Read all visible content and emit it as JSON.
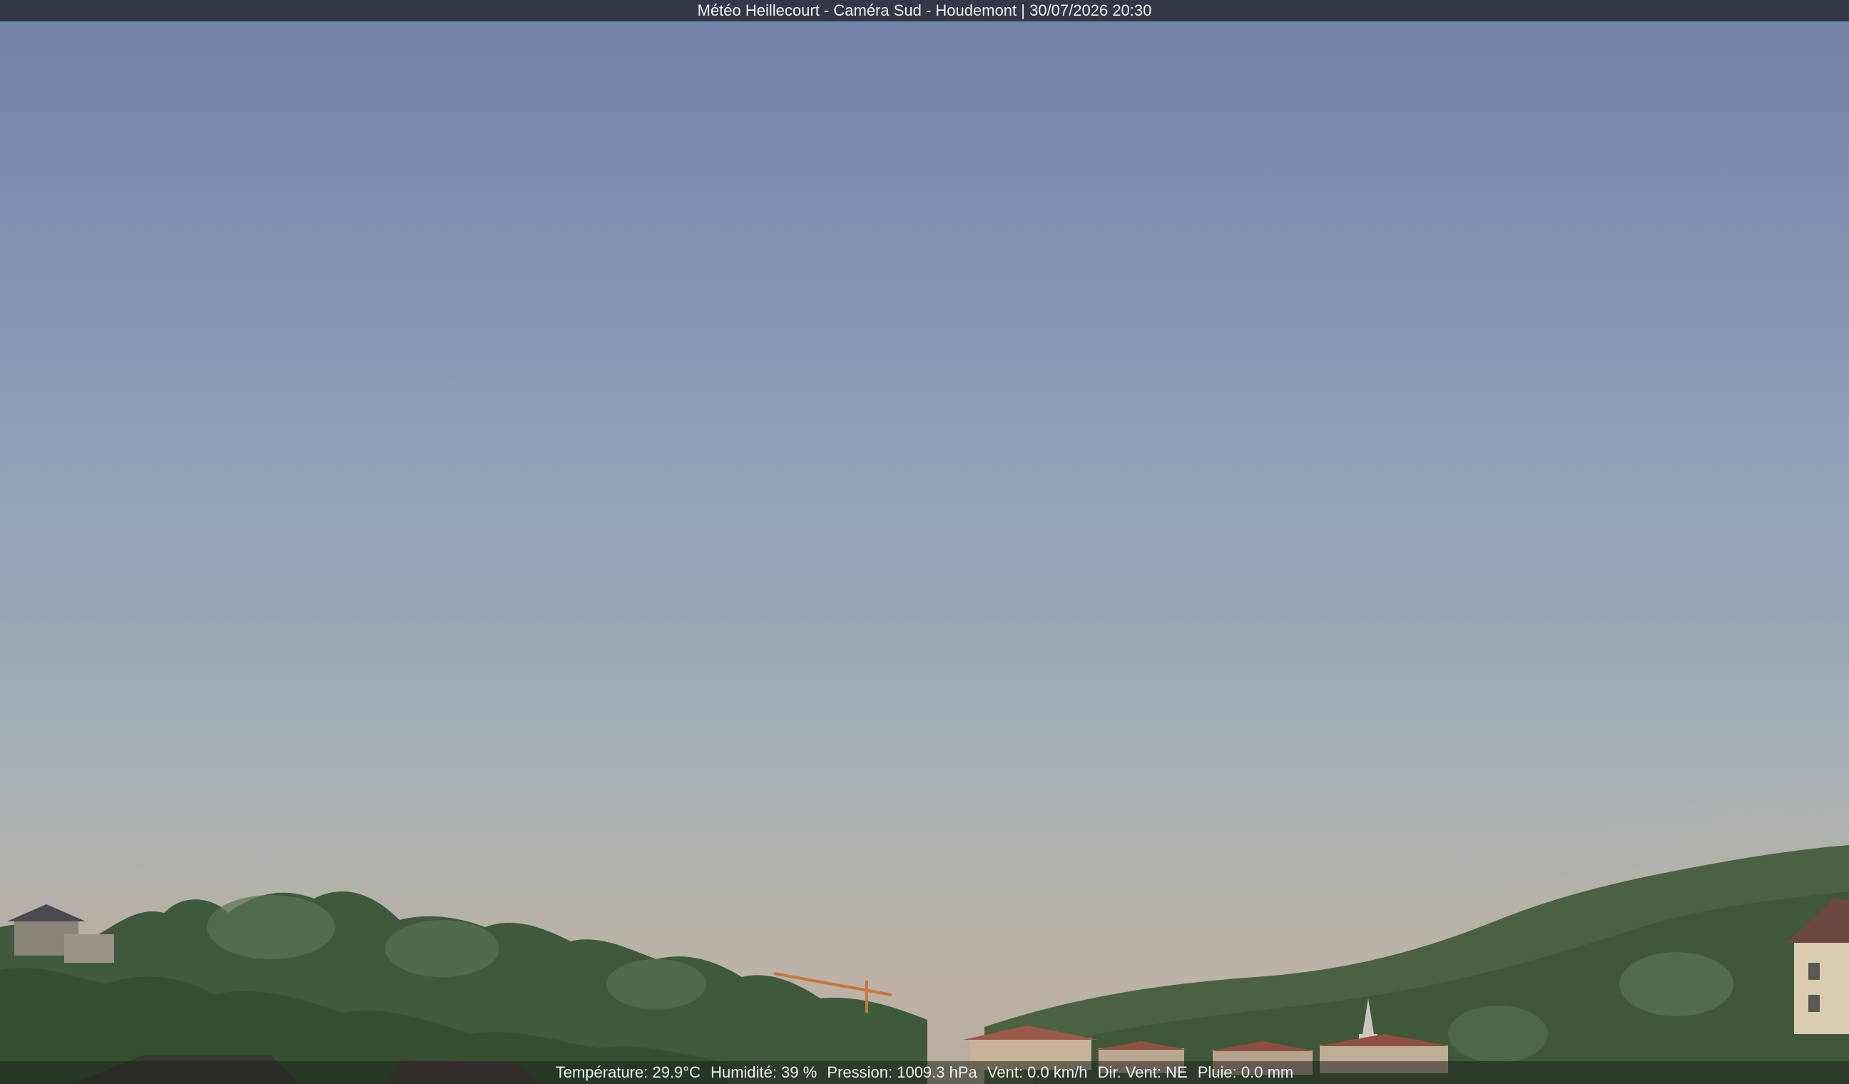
{
  "header": {
    "title": "Météo Heillecourt - Caméra Sud - Houdemont | 30/07/2026 20:30"
  },
  "weather": {
    "temperature": "Température: 29.9°C",
    "humidity": "Humidité: 39 %",
    "pressure": "Pression: 1009.3 hPa",
    "wind": "Vent: 0.0 km/h",
    "wind_dir": "Dir. Vent: NE",
    "rain": "Pluie: 0.0 mm"
  },
  "colors": {
    "sky_top": "#6f82a6",
    "sky_horizon": "#bcb3a6",
    "trees": "#3d5638",
    "roofs": "#9a5a4a"
  }
}
